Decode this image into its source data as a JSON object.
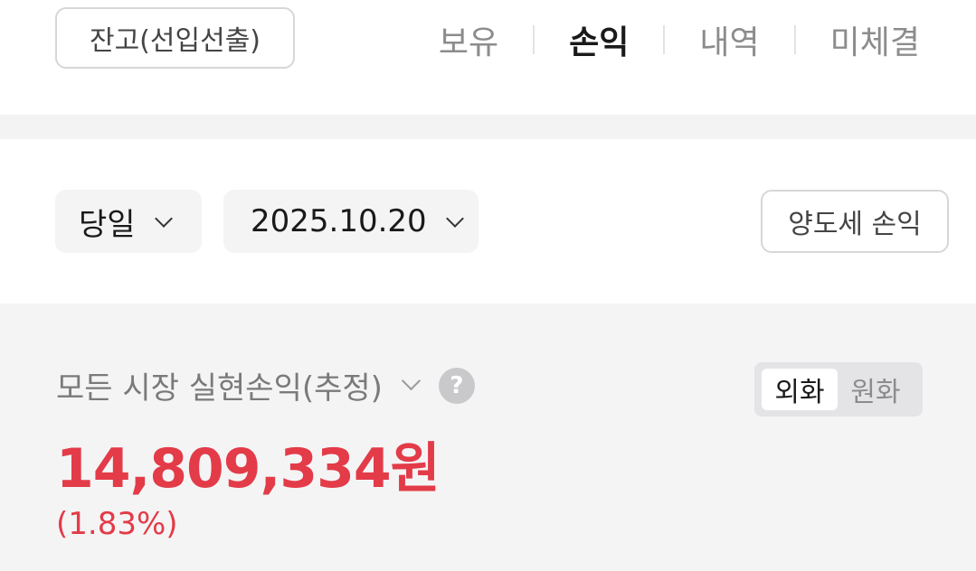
{
  "header": {
    "balance_button": "잔고(선입선출)",
    "tabs": [
      {
        "label": "보유",
        "active": false
      },
      {
        "label": "손익",
        "active": true
      },
      {
        "label": "내역",
        "active": false
      },
      {
        "label": "미체결",
        "active": false
      }
    ]
  },
  "filters": {
    "period": "당일",
    "date": "2025.10.20",
    "tax_button": "양도세 손익"
  },
  "summary": {
    "title": "모든 시장 실현손익(추정)",
    "help_icon": "question-circle-icon",
    "currency_options": [
      {
        "label": "외화",
        "active": true
      },
      {
        "label": "원화",
        "active": false
      }
    ],
    "amount": "14,809,334원",
    "rate": "(1.83%)",
    "accent_color": "#e33b48"
  }
}
